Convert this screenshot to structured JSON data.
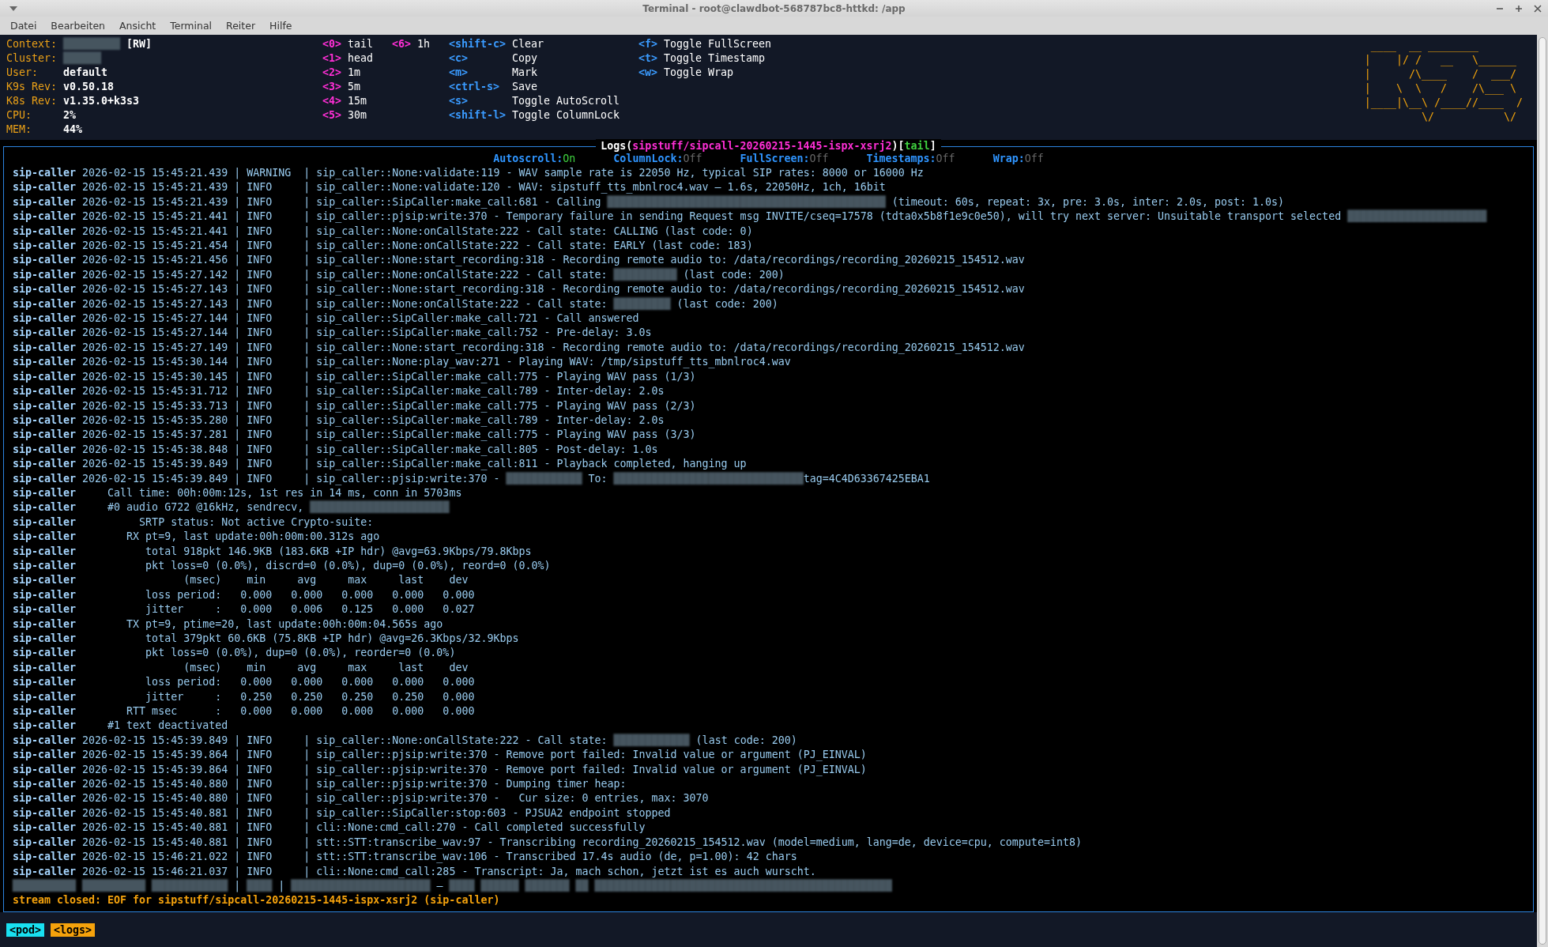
{
  "window": {
    "title": "Terminal - root@clawdbot-568787bc8-httkd: /app"
  },
  "menu": [
    "Datei",
    "Bearbeiten",
    "Ansicht",
    "Terminal",
    "Reiter",
    "Hilfe"
  ],
  "info": [
    {
      "label": "Context:",
      "parts": [
        {
          "redacted": "█████████"
        },
        {
          "text": " [RW]"
        }
      ]
    },
    {
      "label": "Cluster:",
      "parts": [
        {
          "redacted": "██████"
        }
      ]
    },
    {
      "label": "User:",
      "parts": [
        {
          "text": "default"
        }
      ]
    },
    {
      "label": "K9s Rev:",
      "parts": [
        {
          "text": "v0.50.18"
        }
      ]
    },
    {
      "label": "K8s Rev:",
      "parts": [
        {
          "text": "v1.35.0+k3s3"
        }
      ]
    },
    {
      "label": "CPU:",
      "parts": [
        {
          "text": "2%"
        }
      ]
    },
    {
      "label": "MEM:",
      "parts": [
        {
          "text": "44%"
        }
      ]
    }
  ],
  "hint_columns": [
    [
      {
        "key": "<0>",
        "action": "tail",
        "kind": "range"
      },
      {
        "key": "<1>",
        "action": "head",
        "kind": "range"
      },
      {
        "key": "<2>",
        "action": "1m",
        "kind": "range"
      },
      {
        "key": "<3>",
        "action": "5m",
        "kind": "range"
      },
      {
        "key": "<4>",
        "action": "15m",
        "kind": "range"
      },
      {
        "key": "<5>",
        "action": "30m",
        "kind": "range"
      }
    ],
    [
      {
        "key": "<6>",
        "action": "1h",
        "kind": "range"
      }
    ],
    [
      {
        "key": "<shift-c>",
        "action": "Clear",
        "kind": "command"
      },
      {
        "key": "<c>",
        "action": "Copy",
        "kind": "command"
      },
      {
        "key": "<m>",
        "action": "Mark",
        "kind": "command"
      },
      {
        "key": "<ctrl-s>",
        "action": "Save",
        "kind": "command"
      },
      {
        "key": "<s>",
        "action": "Toggle AutoScroll",
        "kind": "command"
      },
      {
        "key": "<shift-l>",
        "action": "Toggle ColumnLock",
        "kind": "command"
      }
    ],
    [
      {
        "key": "<f>",
        "action": "Toggle FullScreen",
        "kind": "command"
      },
      {
        "key": "<t>",
        "action": "Toggle Timestamp",
        "kind": "command"
      },
      {
        "key": "<w>",
        "action": "Toggle Wrap",
        "kind": "command"
      }
    ]
  ],
  "logo": [
    " ____  __ ________       ",
    "|    |/ /   __   \\______",
    "|      /\\____    /  ___/",
    "|    \\  \\   /    /\\___ \\",
    "|____|\\__\\ /____//____  /",
    "         \\/           \\/ "
  ],
  "logs_title": [
    {
      "text": "Logs(",
      "kind": "plain"
    },
    {
      "text": "sipstuff/sipcall-20260215-1445-ispx-xsrj2",
      "kind": "resource"
    },
    {
      "text": ")[",
      "kind": "plain"
    },
    {
      "text": "tail",
      "kind": "mode"
    },
    {
      "text": "]",
      "kind": "plain"
    }
  ],
  "toggles": [
    {
      "label": "Autoscroll:",
      "value": "On",
      "on": true
    },
    {
      "label": "ColumnLock:",
      "value": "Off",
      "on": false
    },
    {
      "label": "FullScreen:",
      "value": "Off",
      "on": false
    },
    {
      "label": "Timestamps:",
      "value": "Off",
      "on": false
    },
    {
      "label": "Wrap:",
      "value": "Off",
      "on": false
    }
  ],
  "log_lines": [
    {
      "pod": "sip-caller",
      "text": "2026-02-15 15:45:21.439 | WARNING  | sip_caller::None:validate:119 - WAV sample rate is 22050 Hz, typical SIP rates: 8000 or 16000 Hz"
    },
    {
      "pod": "sip-caller",
      "text": "2026-02-15 15:45:21.439 | INFO     | sip_caller::None:validate:120 - WAV: sipstuff_tts_mbnlroc4.wav — 1.6s, 22050Hz, 1ch, 16bit"
    },
    {
      "pod": "sip-caller",
      "parts": [
        {
          "text": "2026-02-15 15:45:21.439 | INFO     | sip_caller::SipCaller:make_call:681 - Calling "
        },
        {
          "redacted": "████████████████████████████████████████████"
        },
        {
          "text": " (timeout: 60s, repeat: 3x, pre: 3.0s, inter: 2.0s, post: 1.0s)"
        }
      ]
    },
    {
      "pod": "sip-caller",
      "parts": [
        {
          "text": "2026-02-15 15:45:21.441 | INFO     | sip_caller::pjsip:write:370 - Temporary failure in sending Request msg INVITE/cseq=17578 (tdta0x5b8f1e9c0e50), will try next server: Unsuitable transport selected "
        },
        {
          "redacted": "██████████████████████"
        }
      ]
    },
    {
      "pod": "sip-caller",
      "text": "2026-02-15 15:45:21.441 | INFO     | sip_caller::None:onCallState:222 - Call state: CALLING (last code: 0)"
    },
    {
      "pod": "sip-caller",
      "text": "2026-02-15 15:45:21.454 | INFO     | sip_caller::None:onCallState:222 - Call state: EARLY (last code: 183)"
    },
    {
      "pod": "sip-caller",
      "text": "2026-02-15 15:45:21.456 | INFO     | sip_caller::None:start_recording:318 - Recording remote audio to: /data/recordings/recording_20260215_154512.wav"
    },
    {
      "pod": "sip-caller",
      "parts": [
        {
          "text": "2026-02-15 15:45:27.142 | INFO     | sip_caller::None:onCallState:222 - Call state: "
        },
        {
          "redacted": "██████████"
        },
        {
          "text": " (last code: 200)"
        }
      ]
    },
    {
      "pod": "sip-caller",
      "text": "2026-02-15 15:45:27.143 | INFO     | sip_caller::None:start_recording:318 - Recording remote audio to: /data/recordings/recording_20260215_154512.wav"
    },
    {
      "pod": "sip-caller",
      "parts": [
        {
          "text": "2026-02-15 15:45:27.143 | INFO     | sip_caller::None:onCallState:222 - Call state: "
        },
        {
          "redacted": "█████████"
        },
        {
          "text": " (last code: 200)"
        }
      ]
    },
    {
      "pod": "sip-caller",
      "text": "2026-02-15 15:45:27.144 | INFO     | sip_caller::SipCaller:make_call:721 - Call answered"
    },
    {
      "pod": "sip-caller",
      "text": "2026-02-15 15:45:27.144 | INFO     | sip_caller::SipCaller:make_call:752 - Pre-delay: 3.0s"
    },
    {
      "pod": "sip-caller",
      "text": "2026-02-15 15:45:27.149 | INFO     | sip_caller::None:start_recording:318 - Recording remote audio to: /data/recordings/recording_20260215_154512.wav"
    },
    {
      "pod": "sip-caller",
      "text": "2026-02-15 15:45:30.144 | INFO     | sip_caller::None:play_wav:271 - Playing WAV: /tmp/sipstuff_tts_mbnlroc4.wav"
    },
    {
      "pod": "sip-caller",
      "text": "2026-02-15 15:45:30.145 | INFO     | sip_caller::SipCaller:make_call:775 - Playing WAV pass (1/3)"
    },
    {
      "pod": "sip-caller",
      "text": "2026-02-15 15:45:31.712 | INFO     | sip_caller::SipCaller:make_call:789 - Inter-delay: 2.0s"
    },
    {
      "pod": "sip-caller",
      "text": "2026-02-15 15:45:33.713 | INFO     | sip_caller::SipCaller:make_call:775 - Playing WAV pass (2/3)"
    },
    {
      "pod": "sip-caller",
      "text": "2026-02-15 15:45:35.280 | INFO     | sip_caller::SipCaller:make_call:789 - Inter-delay: 2.0s"
    },
    {
      "pod": "sip-caller",
      "text": "2026-02-15 15:45:37.281 | INFO     | sip_caller::SipCaller:make_call:775 - Playing WAV pass (3/3)"
    },
    {
      "pod": "sip-caller",
      "text": "2026-02-15 15:45:38.848 | INFO     | sip_caller::SipCaller:make_call:805 - Post-delay: 1.0s"
    },
    {
      "pod": "sip-caller",
      "text": "2026-02-15 15:45:39.849 | INFO     | sip_caller::SipCaller:make_call:811 - Playback completed, hanging up"
    },
    {
      "pod": "sip-caller",
      "parts": [
        {
          "text": "2026-02-15 15:45:39.849 | INFO     | sip_caller::pjsip:write:370 - "
        },
        {
          "redacted": "████████████"
        },
        {
          "text": " To: "
        },
        {
          "redacted": "██████████████████████████████"
        },
        {
          "text": "tag=4C4D63367425EBA1"
        }
      ]
    },
    {
      "pod": "sip-caller",
      "text": "    Call time: 00h:00m:12s, 1st res in 14 ms, conn in 5703ms"
    },
    {
      "pod": "sip-caller",
      "parts": [
        {
          "text": "    #0 audio G722 @16kHz, sendrecv, "
        },
        {
          "redacted": "██████████████████████"
        }
      ]
    },
    {
      "pod": "sip-caller",
      "text": "         SRTP status: Not active Crypto-suite:"
    },
    {
      "pod": "sip-caller",
      "text": "       RX pt=9, last update:00h:00m:00.312s ago"
    },
    {
      "pod": "sip-caller",
      "text": "          total 918pkt 146.9KB (183.6KB +IP hdr) @avg=63.9Kbps/79.8Kbps"
    },
    {
      "pod": "sip-caller",
      "text": "          pkt loss=0 (0.0%), discrd=0 (0.0%), dup=0 (0.0%), reord=0 (0.0%)"
    },
    {
      "pod": "sip-caller",
      "text": "                (msec)    min     avg     max     last    dev"
    },
    {
      "pod": "sip-caller",
      "text": "          loss period:   0.000   0.000   0.000   0.000   0.000"
    },
    {
      "pod": "sip-caller",
      "text": "          jitter     :   0.000   0.006   0.125   0.000   0.027"
    },
    {
      "pod": "sip-caller",
      "text": "       TX pt=9, ptime=20, last update:00h:00m:04.565s ago"
    },
    {
      "pod": "sip-caller",
      "text": "          total 379pkt 60.6KB (75.8KB +IP hdr) @avg=26.3Kbps/32.9Kbps"
    },
    {
      "pod": "sip-caller",
      "text": "          pkt loss=0 (0.0%), dup=0 (0.0%), reorder=0 (0.0%)"
    },
    {
      "pod": "sip-caller",
      "text": "                (msec)    min     avg     max     last    dev"
    },
    {
      "pod": "sip-caller",
      "text": "          loss period:   0.000   0.000   0.000   0.000   0.000"
    },
    {
      "pod": "sip-caller",
      "text": "          jitter     :   0.250   0.250   0.250   0.250   0.000"
    },
    {
      "pod": "sip-caller",
      "text": "       RTT msec      :   0.000   0.000   0.000   0.000   0.000"
    },
    {
      "pod": "sip-caller",
      "text": "    #1 text deactivated"
    },
    {
      "pod": "sip-caller",
      "parts": [
        {
          "text": "2026-02-15 15:45:39.849 | INFO     | sip_caller::None:onCallState:222 - Call state: "
        },
        {
          "redacted": "████████████"
        },
        {
          "text": " (last code: 200)"
        }
      ]
    },
    {
      "pod": "sip-caller",
      "text": "2026-02-15 15:45:39.864 | INFO     | sip_caller::pjsip:write:370 - Remove port failed: Invalid value or argument (PJ_EINVAL)"
    },
    {
      "pod": "sip-caller",
      "text": "2026-02-15 15:45:39.864 | INFO     | sip_caller::pjsip:write:370 - Remove port failed: Invalid value or argument (PJ_EINVAL)"
    },
    {
      "pod": "sip-caller",
      "text": "2026-02-15 15:45:40.880 | INFO     | sip_caller::pjsip:write:370 - Dumping timer heap:"
    },
    {
      "pod": "sip-caller",
      "text": "2026-02-15 15:45:40.880 | INFO     | sip_caller::pjsip:write:370 -   Cur size: 0 entries, max: 3070"
    },
    {
      "pod": "sip-caller",
      "text": "2026-02-15 15:45:40.881 | INFO     | sip_caller::SipCaller:stop:603 - PJSUA2 endpoint stopped"
    },
    {
      "pod": "sip-caller",
      "text": "2026-02-15 15:45:40.881 | INFO     | cli::None:cmd_call:270 - Call completed successfully"
    },
    {
      "pod": "sip-caller",
      "text": "2026-02-15 15:45:40.881 | INFO     | stt::STT:transcribe_wav:97 - Transcribing recording_20260215_154512.wav (model=medium, lang=de, device=cpu, compute=int8)"
    },
    {
      "pod": "sip-caller",
      "text": "2026-02-15 15:46:21.022 | INFO     | stt::STT:transcribe_wav:106 - Transcribed 17.4s audio (de, p=1.00): 42 chars"
    },
    {
      "pod": "sip-caller",
      "text": "2026-02-15 15:46:21.037 | INFO     | cli::None:cmd_call:285 - Transcript: Ja, mach schon, jetzt ist es auch wurscht."
    },
    {
      "parts": [
        {
          "redacted": "██████████ ██████████ ████████████"
        },
        {
          "text": " | "
        },
        {
          "redacted": "████"
        },
        {
          "text": " | "
        },
        {
          "redacted": "██████████████████████"
        },
        {
          "text": " – "
        },
        {
          "redacted": "████ ██████ ███████ ██ ███████████████████████████████████████████████"
        }
      ]
    }
  ],
  "stream_status": "stream closed: EOF for sipstuff/sipcall-20260215-1445-ispx-xsrj2 (sip-caller)",
  "crumbs": [
    {
      "label": "<pod>",
      "selected": false
    },
    {
      "label": "<logs>",
      "selected": true
    }
  ]
}
